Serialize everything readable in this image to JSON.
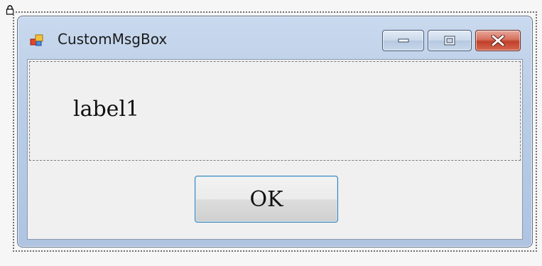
{
  "window": {
    "title": "CustomMsgBox",
    "icon": "app-window-icon"
  },
  "caption_buttons": {
    "minimize_icon": "minimize-icon",
    "maximize_icon": "maximize-icon",
    "close_icon": "close-icon"
  },
  "content": {
    "label_text": "label1",
    "ok_label": "OK"
  },
  "designer": {
    "lock_icon": "lock-icon"
  },
  "colors": {
    "close_button": "#c0402a",
    "ok_button_border": "#3c7fb1",
    "title_bar": "#b9cde6"
  }
}
